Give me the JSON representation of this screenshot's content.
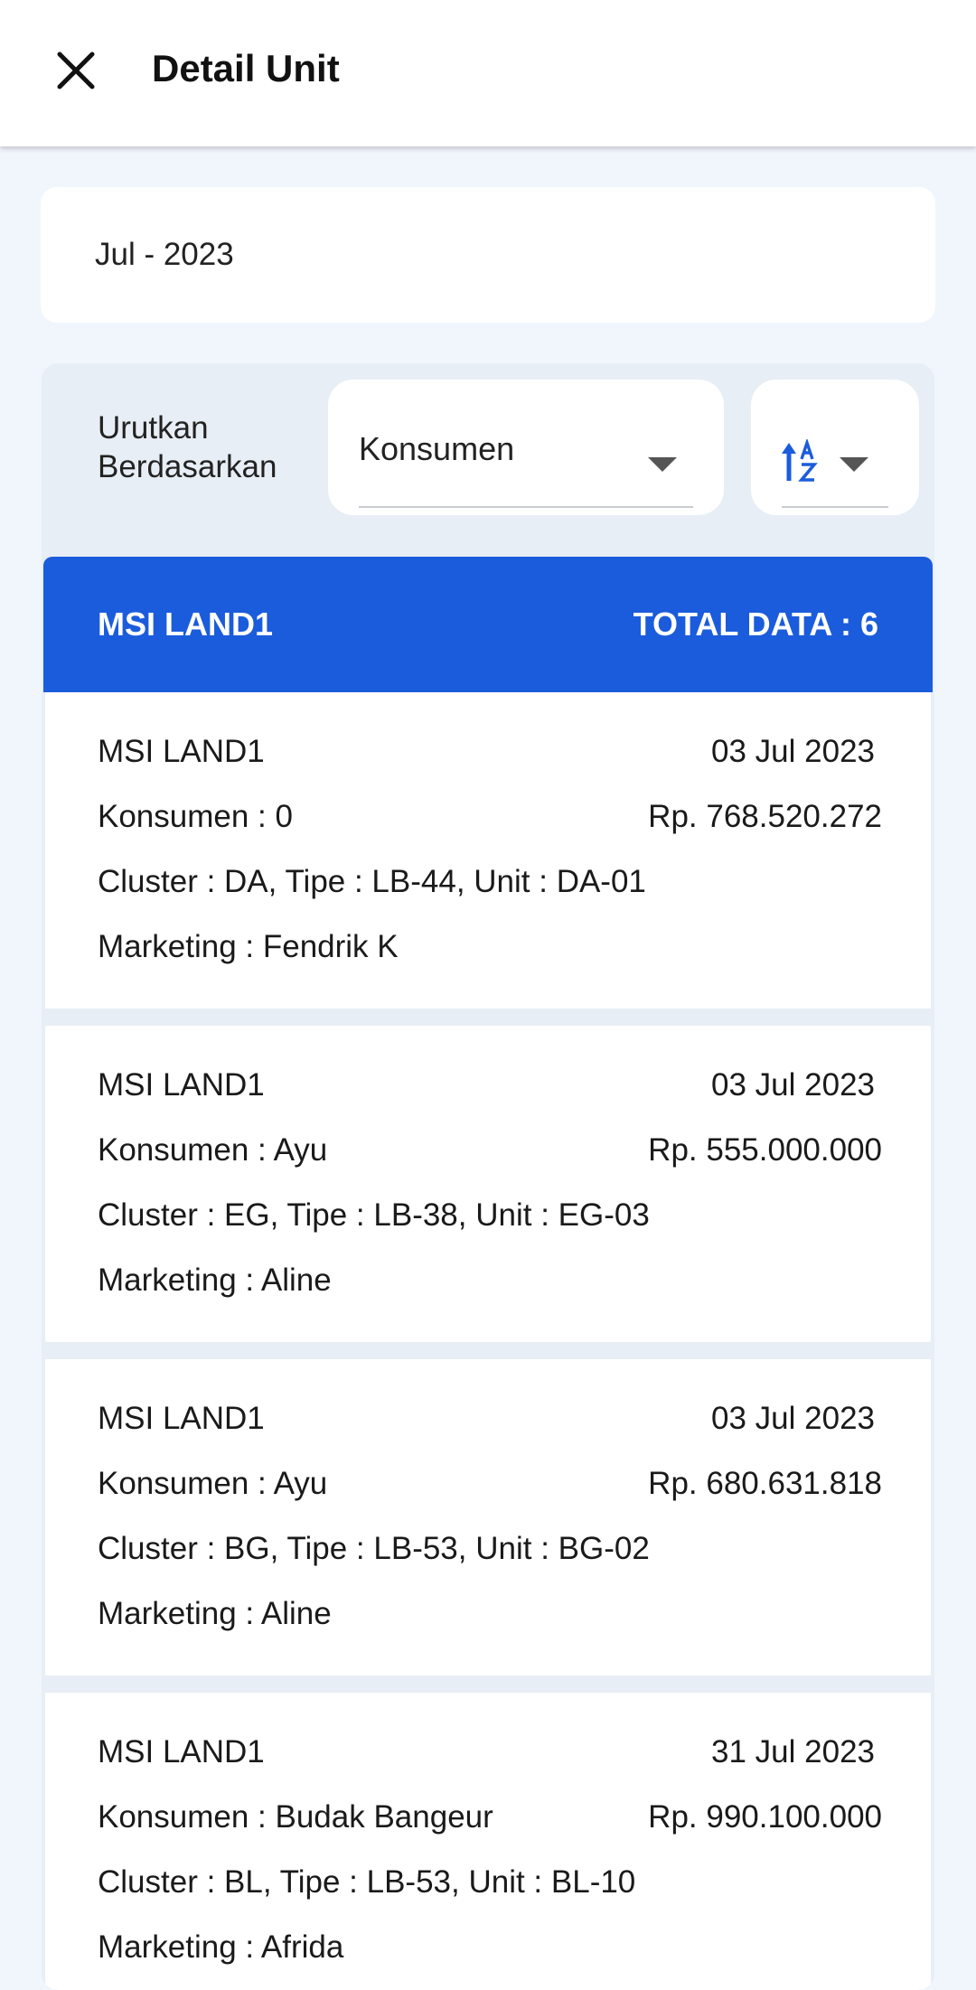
{
  "appbar": {
    "title": "Detail Unit",
    "close_icon": "close-icon"
  },
  "period": {
    "value": "Jul - 2023"
  },
  "sort": {
    "label": "Urutkan Berdasarkan",
    "selected": "Konsumen",
    "order_icon": "sort-alpha-ascending-icon"
  },
  "group": {
    "name": "MSI LAND1",
    "total": "TOTAL DATA : 6"
  },
  "items": [
    {
      "company": "MSI LAND1",
      "date": "03 Jul 2023",
      "konsumen": "Konsumen : 0",
      "price": "Rp. 768.520.272",
      "detail": "Cluster : DA, Tipe : LB-44, Unit : DA-01",
      "marketing": "Marketing : Fendrik K"
    },
    {
      "company": "MSI LAND1",
      "date": "03 Jul 2023",
      "konsumen": "Konsumen : Ayu",
      "price": "Rp. 555.000.000",
      "detail": "Cluster : EG, Tipe : LB-38, Unit : EG-03",
      "marketing": "Marketing : Aline"
    },
    {
      "company": "MSI LAND1",
      "date": "03 Jul 2023",
      "konsumen": "Konsumen : Ayu",
      "price": "Rp. 680.631.818",
      "detail": "Cluster : BG, Tipe : LB-53, Unit : BG-02",
      "marketing": "Marketing : Aline"
    },
    {
      "company": "MSI LAND1",
      "date": "31 Jul 2023",
      "konsumen": "Konsumen : Budak Bangeur",
      "price": "Rp. 990.100.000",
      "detail": "Cluster : BL, Tipe : LB-53, Unit : BL-10",
      "marketing": "Marketing : Afrida"
    }
  ],
  "colors": {
    "primary": "#1b5cdc",
    "background": "#f1f6fc",
    "panel": "#e8eef5"
  }
}
